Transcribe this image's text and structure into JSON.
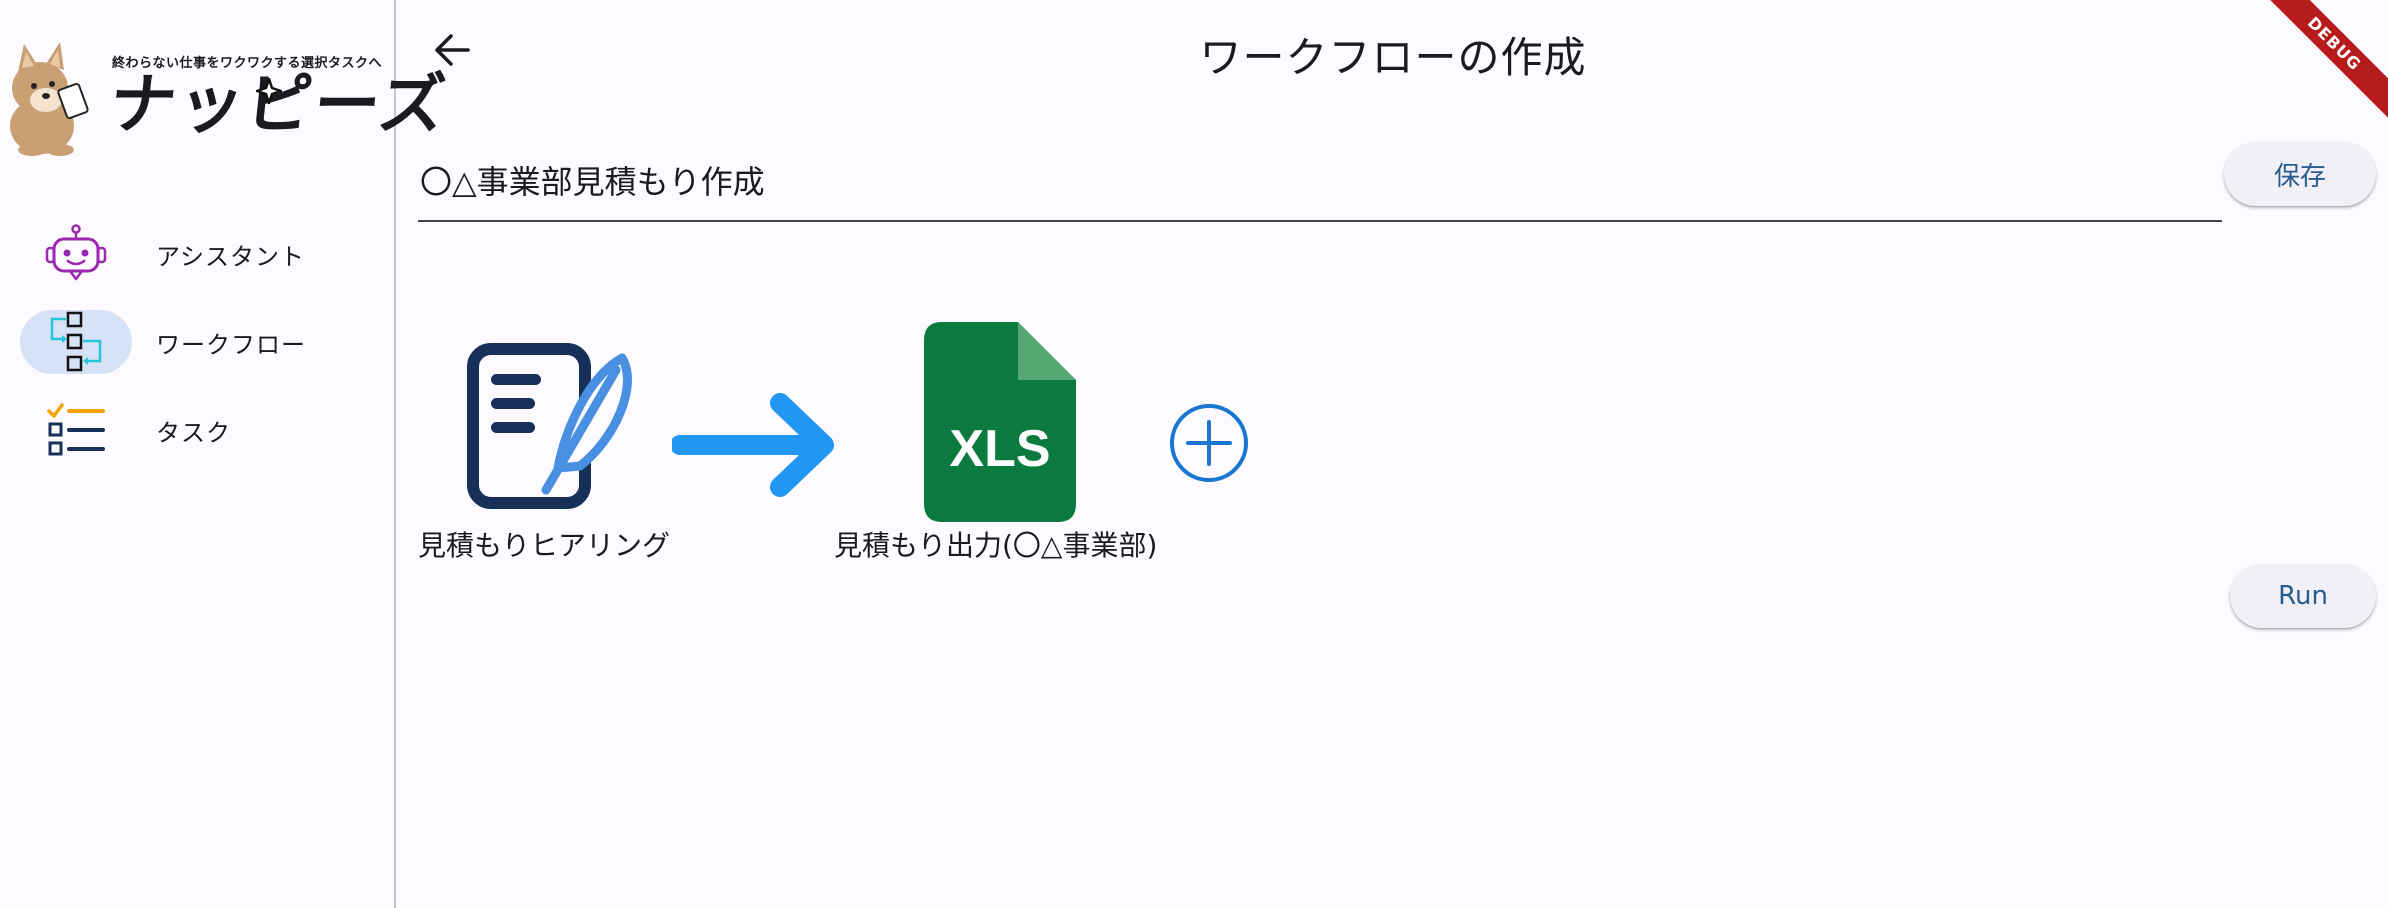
{
  "sidebar": {
    "tagline": "終わらない仕事をワクワクする選択タスクへ",
    "brand": "ナッピーズ",
    "items": [
      {
        "label": "アシスタント",
        "icon": "robot-icon",
        "active": false
      },
      {
        "label": "ワークフロー",
        "icon": "workflow-icon",
        "active": true
      },
      {
        "label": "タスク",
        "icon": "checklist-icon",
        "active": false
      }
    ]
  },
  "header": {
    "title": "ワークフローの作成"
  },
  "workflow": {
    "name_value": "〇△事業部見積もり作成",
    "save_label": "保存",
    "run_label": "Run",
    "nodes": [
      {
        "label": "見積もりヒアリング",
        "icon": "document-feather-icon"
      },
      {
        "label": "見積もり出力(〇△事業部)",
        "icon": "xls-file-icon",
        "badge": "XLS"
      }
    ]
  },
  "debug_label": "DEBUG",
  "colors": {
    "accent": "#2a5d8f",
    "nav_active_bg": "#d6e3f7",
    "arrow_blue": "#2196f3",
    "xls_green": "#0b7a3e",
    "doc_navy": "#16305a",
    "robot_purple": "#9c27b0",
    "debug_red": "#b71c1c"
  }
}
